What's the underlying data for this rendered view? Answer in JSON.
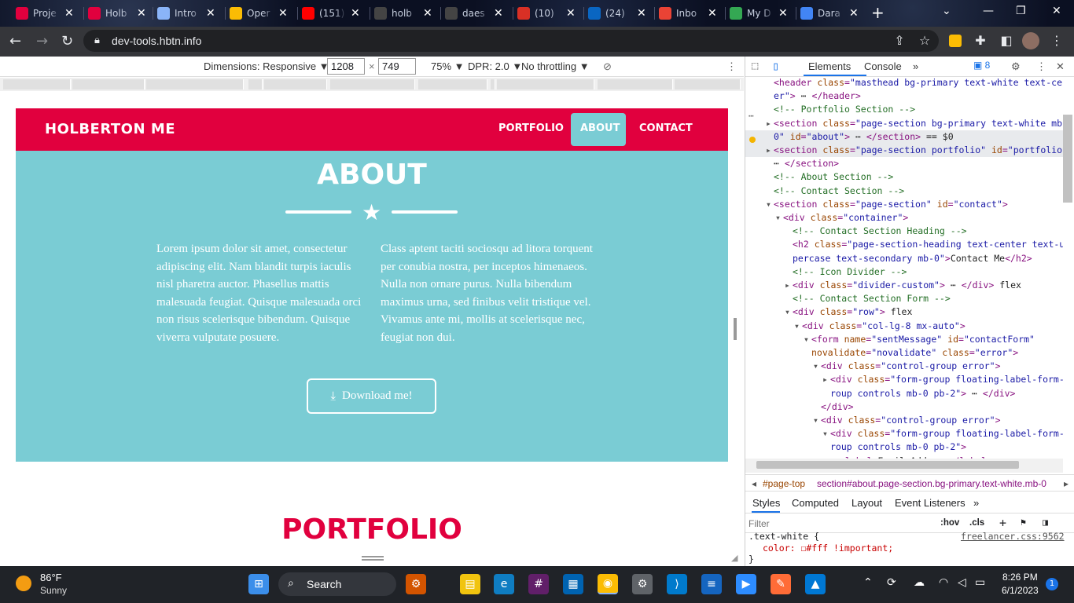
{
  "browser": {
    "tabs": [
      {
        "title": "Proje",
        "icon": "holberton-icon",
        "color": "#e1003e"
      },
      {
        "title": "Holb",
        "icon": "holberton-icon",
        "color": "#e1003e"
      },
      {
        "title": "Intro",
        "icon": "book-icon",
        "color": "#8ab4f8"
      },
      {
        "title": "Oper",
        "icon": "chrome-icon",
        "color": "#fbbc04"
      },
      {
        "title": "(151)",
        "icon": "youtube-icon",
        "color": "#ff0000"
      },
      {
        "title": "holb",
        "icon": "github-icon",
        "color": "#444"
      },
      {
        "title": "daes",
        "icon": "github-icon",
        "color": "#444"
      },
      {
        "title": "(10)",
        "icon": "notification-icon",
        "color": "#d93025"
      },
      {
        "title": "(24)",
        "icon": "linkedin-icon",
        "color": "#0a66c2"
      },
      {
        "title": "Inbo",
        "icon": "gmail-icon",
        "color": "#ea4335"
      },
      {
        "title": "My D",
        "icon": "drive-icon",
        "color": "#34a853"
      },
      {
        "title": "Dara",
        "icon": "docs-icon",
        "color": "#4285f4"
      }
    ],
    "url": "dev-tools.hbtn.info"
  },
  "device_toolbar": {
    "dimensions": "Dimensions: Responsive ▼",
    "width": "1208",
    "height": "749",
    "zoom": "75% ▼",
    "dpr": "DPR: 2.0 ▼",
    "throttling": "No throttling ▼"
  },
  "site": {
    "brand": "HOLBERTON ME",
    "nav": [
      "PORTFOLIO",
      "ABOUT",
      "CONTACT"
    ],
    "about_title": "ABOUT",
    "para_left": "Lorem ipsum dolor sit amet, consectetur adipiscing elit. Nam blandit turpis iaculis nisl pharetra auctor. Phasellus mattis malesuada feugiat. Quisque malesuada orci non risus scelerisque bibendum. Quisque viverra vulputate posuere.",
    "para_right": "Class aptent taciti sociosqu ad litora torquent per conubia nostra, per inceptos himenaeos. Nulla non ornare purus. Nulla bibendum maximus urna, sed finibus velit tristique vel. Vivamus ante mi, mollis at scelerisque nec, feugiat non dui.",
    "download": "Download me!",
    "portfolio_title": "PORTFOLIO",
    "colors": {
      "primary": "#e1003e",
      "secondary": "#7accd4"
    }
  },
  "devtools": {
    "tabs": [
      "Elements",
      "Console"
    ],
    "badge": "8",
    "dom_lines": [
      {
        "indent": 36,
        "html": "<span class='dtag'>&lt;header</span> <span class='dattr'>class</span>=<span class='dval'>\"masthead bg-primary text-white text-cent</span>"
      },
      {
        "indent": 36,
        "html": "<span class='dval'>er\"</span><span class='dtag'>&gt;</span> <span class='dtxt'>⋯</span> <span class='dtag'>&lt;/header&gt;</span>"
      },
      {
        "indent": 36,
        "html": "<span class='dcmt'>&lt;!-- Portfolio Section --&gt;</span>"
      },
      {
        "indent": 36,
        "html": "<span class='dtag'>&lt;section</span> <span class='dattr'>class</span>=<span class='dval'>\"page-section bg-primary text-white mb-</span>"
      },
      {
        "indent": 36,
        "html": "<span class='dval'>0\"</span> <span class='dattr'>id</span>=<span class='dval'>\"about\"</span><span class='dtag'>&gt;</span> <span class='dtxt'>⋯</span> <span class='dtag'>&lt;/section&gt;</span> <span class='dtxt'>== $0</span>"
      },
      {
        "indent": 36,
        "html": "<span class='dtag'>&lt;section</span> <span class='dattr'>class</span>=<span class='dval'>\"page-section portfolio\"</span> <span class='dattr'>id</span>=<span class='dval'>\"portfolio\"</span><span class='dtag'>&gt;</span>"
      },
      {
        "indent": 36,
        "html": "<span class='dtxt'>⋯</span> <span class='dtag'>&lt;/section&gt;</span>"
      },
      {
        "indent": 36,
        "html": "<span class='dcmt'>&lt;!-- About Section --&gt;</span>"
      },
      {
        "indent": 36,
        "html": "<span class='dcmt'>&lt;!-- Contact Section --&gt;</span>"
      },
      {
        "indent": 36,
        "html": "<span class='dtag'>&lt;section</span> <span class='dattr'>class</span>=<span class='dval'>\"page-section\"</span> <span class='dattr'>id</span>=<span class='dval'>\"contact\"</span><span class='dtag'>&gt;</span>"
      },
      {
        "indent": 48,
        "html": "<span class='dtag'>&lt;div</span> <span class='dattr'>class</span>=<span class='dval'>\"container\"</span><span class='dtag'>&gt;</span>"
      },
      {
        "indent": 60,
        "html": "<span class='dcmt'>&lt;!-- Contact Section Heading --&gt;</span>"
      },
      {
        "indent": 60,
        "html": "<span class='dtag'>&lt;h2</span> <span class='dattr'>class</span>=<span class='dval'>\"page-section-heading text-center text-up</span>"
      },
      {
        "indent": 60,
        "html": "<span class='dval'>percase text-secondary mb-0\"</span><span class='dtag'>&gt;</span><span class='dtxt'>Contact Me</span><span class='dtag'>&lt;/h2&gt;</span>"
      },
      {
        "indent": 60,
        "html": "<span class='dcmt'>&lt;!-- Icon Divider --&gt;</span>"
      },
      {
        "indent": 60,
        "html": "<span class='dtag'>&lt;div</span> <span class='dattr'>class</span>=<span class='dval'>\"divider-custom\"</span><span class='dtag'>&gt;</span> <span class='dtxt'>⋯</span> <span class='dtag'>&lt;/div&gt;</span> <span class='dtxt'>flex</span>"
      },
      {
        "indent": 60,
        "html": "<span class='dcmt'>&lt;!-- Contact Section Form --&gt;</span>"
      },
      {
        "indent": 60,
        "html": "<span class='dtag'>&lt;div</span> <span class='dattr'>class</span>=<span class='dval'>\"row\"</span><span class='dtag'>&gt;</span> <span class='dtxt'>flex</span>"
      },
      {
        "indent": 72,
        "html": "<span class='dtag'>&lt;div</span> <span class='dattr'>class</span>=<span class='dval'>\"col-lg-8 mx-auto\"</span><span class='dtag'>&gt;</span>"
      },
      {
        "indent": 84,
        "html": "<span class='dtag'>&lt;form</span> <span class='dattr'>name</span>=<span class='dval'>\"sentMessage\"</span> <span class='dattr'>id</span>=<span class='dval'>\"contactForm\"</span>"
      },
      {
        "indent": 84,
        "html": "<span class='dattr'>novalidate</span>=<span class='dval'>\"novalidate\"</span> <span class='dattr'>class</span>=<span class='dval'>\"error\"</span><span class='dtag'>&gt;</span>"
      },
      {
        "indent": 96,
        "html": "<span class='dtag'>&lt;div</span> <span class='dattr'>class</span>=<span class='dval'>\"control-group error\"</span><span class='dtag'>&gt;</span>"
      },
      {
        "indent": 108,
        "html": "<span class='dtag'>&lt;div</span> <span class='dattr'>class</span>=<span class='dval'>\"form-group floating-label-form-g</span>"
      },
      {
        "indent": 108,
        "html": "<span class='dval'>roup controls mb-0 pb-2\"</span><span class='dtag'>&gt;</span> <span class='dtxt'>⋯</span> <span class='dtag'>&lt;/div&gt;</span>"
      },
      {
        "indent": 96,
        "html": "<span class='dtag'>&lt;/div&gt;</span>"
      },
      {
        "indent": 96,
        "html": "<span class='dtag'>&lt;div</span> <span class='dattr'>class</span>=<span class='dval'>\"control-group error\"</span><span class='dtag'>&gt;</span>"
      },
      {
        "indent": 108,
        "html": "<span class='dtag'>&lt;div</span> <span class='dattr'>class</span>=<span class='dval'>\"form-group floating-label-form-g</span>"
      },
      {
        "indent": 108,
        "html": "<span class='dval'>roup controls mb-0 pb-2\"</span><span class='dtag'>&gt;</span>"
      },
      {
        "indent": 120,
        "html": "<span class='dtag'>&lt;label&gt;</span><span class='dtxt'>Email Address</span><span class='dtag'>&lt;/label&gt;</span>"
      }
    ],
    "breadcrumb": {
      "first": "#page-top",
      "second": "section#about.page-section.bg-primary.text-white.mb-0"
    },
    "styles_tabs": [
      "Styles",
      "Computed",
      "Layout",
      "Event Listeners"
    ],
    "filter_placeholder": "Filter",
    "hov": ":hov",
    "cls": ".cls",
    "css_selector": ".text-white {",
    "css_source": "freelancer.css:9562",
    "css_rule": "color: ☐#fff !important;",
    "css_close": "}"
  },
  "taskbar": {
    "weather_temp": "86°F",
    "weather_desc": "Sunny",
    "search": "Search",
    "time": "8:26 PM",
    "date": "6/1/2023",
    "notification_count": "1"
  }
}
